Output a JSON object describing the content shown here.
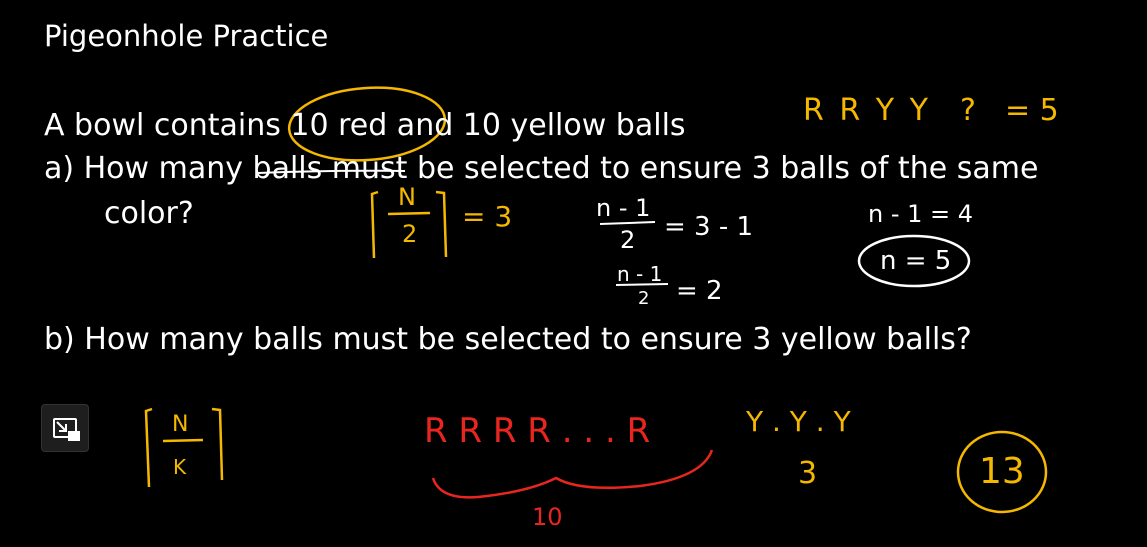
{
  "title": "Pigeonhole Practice",
  "problem": {
    "intro": "A bowl contains 10 red and 10 yellow balls",
    "part_a_line1": "a)  How many balls must be selected to ensure 3 balls of the same",
    "part_a_line2": "color?",
    "part_b": "b)  How many balls must be selected to ensure 3 yellow balls?"
  },
  "annotations": {
    "rryy": "R R Y Y",
    "rryy_q": "?",
    "rryy_eq": "= 5",
    "ceil_num": "N",
    "ceil_den": "2",
    "ceil_eq": "= 3",
    "frac1_num": "n - 1",
    "frac1_den": "2",
    "frac1_eq": "= 3 - 1",
    "frac2_num": "n - 1",
    "frac2_den": "2",
    "frac2_eq": "= 2",
    "n_minus": "n - 1 = 4",
    "n_result": "n = 5",
    "ceil2_num": "N",
    "ceil2_den": "K",
    "red_seq": "R R R R . . . R",
    "red_count": "10",
    "yellow_seq": "Y . Y . Y",
    "yellow_count": "3",
    "answer_b": "13"
  },
  "colors": {
    "background": "#000000",
    "ink_white": "#ffffff",
    "ink_yellow": "#f5b800",
    "ink_red": "#e8261f"
  },
  "icons": {
    "pip": "picture-in-picture-icon"
  }
}
